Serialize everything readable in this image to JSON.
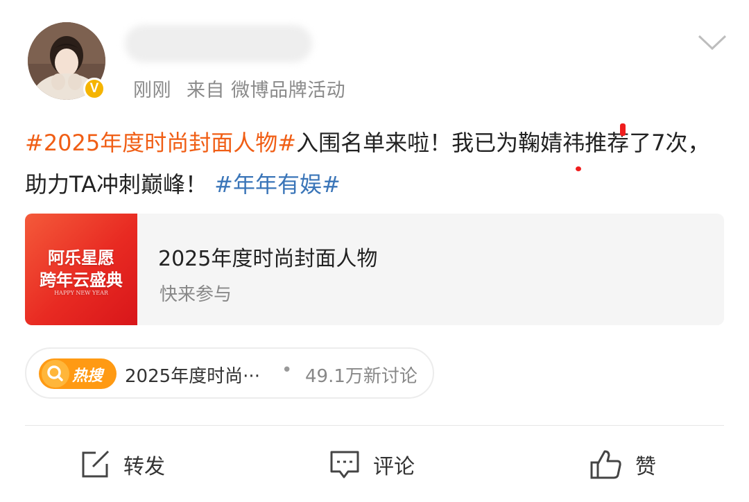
{
  "header": {
    "time": "刚刚",
    "source_prefix": "来自",
    "source": "微博品牌活动",
    "verified_badge": "V",
    "verified_color": "#f5b400"
  },
  "post": {
    "tag1": "#2025年度时尚封面人物#",
    "text": "入围名单来啦！我已为鞠婧祎推荐了7次，助力TA冲刺巅峰！",
    "tag2": "#年年有娱#",
    "tag1_color": "#f05e15",
    "tag2_color": "#3a75b8"
  },
  "card": {
    "image_line1": "阿乐星愿",
    "image_line2": "跨年云盛典",
    "image_line3": "HAPPY NEW YEAR",
    "title": "2025年度时尚封面人物",
    "subtitle": "快来参与"
  },
  "hot_search": {
    "badge": "热搜",
    "title": "2025年度时尚···",
    "separator": "•",
    "count": "49.1万新讨论",
    "badge_color": "#ff9a13"
  },
  "actions": {
    "repost": "转发",
    "comment": "评论",
    "like": "赞"
  },
  "icons": {
    "repost": "edit-share-icon",
    "comment": "comment-bubble-icon",
    "like": "thumbs-up-icon",
    "menu": "chevron-down-icon",
    "search": "search-icon"
  }
}
